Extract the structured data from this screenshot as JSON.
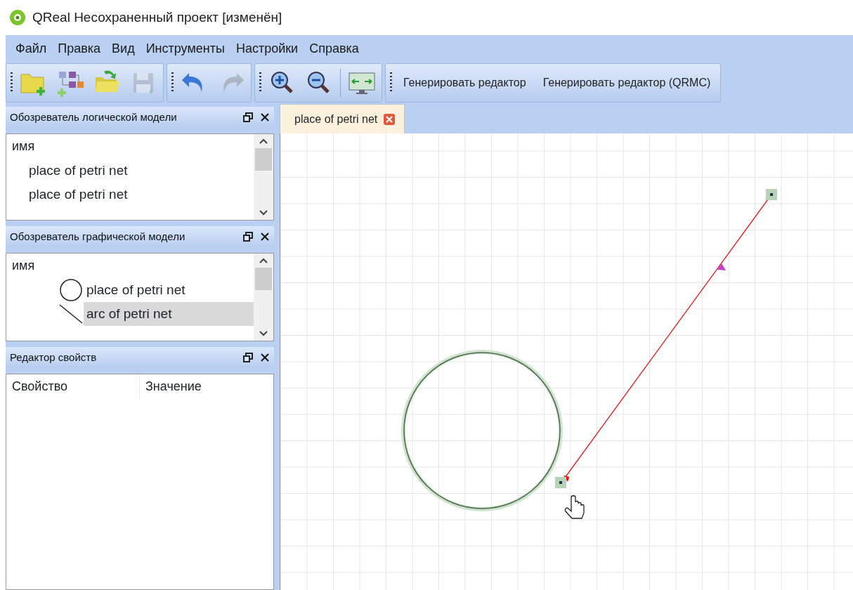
{
  "window": {
    "title": "QReal Несохраненный проект [изменён]"
  },
  "menu": [
    "Файл",
    "Правка",
    "Вид",
    "Инструменты",
    "Настройки",
    "Справка"
  ],
  "toolbars": [
    {
      "items": [
        {
          "kind": "new-project",
          "disabled": false
        },
        {
          "kind": "new-diagram",
          "disabled": false
        },
        {
          "kind": "open",
          "disabled": false
        },
        {
          "kind": "save",
          "disabled": true
        }
      ]
    },
    {
      "items": [
        {
          "kind": "undo",
          "disabled": false
        },
        {
          "kind": "redo",
          "disabled": true
        }
      ]
    },
    {
      "items": [
        {
          "kind": "zoom-in",
          "disabled": false
        },
        {
          "kind": "zoom-out",
          "disabled": false
        },
        {
          "kind": "separator"
        },
        {
          "kind": "fit",
          "disabled": false
        }
      ]
    },
    {
      "items": [
        {
          "kind": "text",
          "label": "Генерировать редактор"
        },
        {
          "kind": "text",
          "label": "Генерировать редактор (QRMC)"
        }
      ]
    }
  ],
  "logical_explorer": {
    "title": "Обозреватель логической модели",
    "column": "имя",
    "items": [
      {
        "label": "place of petri net"
      },
      {
        "label": "place of petri net"
      }
    ]
  },
  "graphical_explorer": {
    "title": "Обозреватель графической модели",
    "column": "имя",
    "items": [
      {
        "kind": "place",
        "label": "place of petri net",
        "selected": false
      },
      {
        "kind": "arc",
        "label": "arc of petri net",
        "selected": true
      }
    ]
  },
  "property_editor": {
    "title": "Редактор свойств",
    "columns": [
      "Свойство",
      "Значение"
    ]
  },
  "tabs": [
    {
      "label": "place of petri net",
      "selected": true
    }
  ],
  "canvas": {
    "elements": [
      {
        "kind": "place",
        "selected": false
      },
      {
        "kind": "arc",
        "selected": true
      }
    ]
  }
}
